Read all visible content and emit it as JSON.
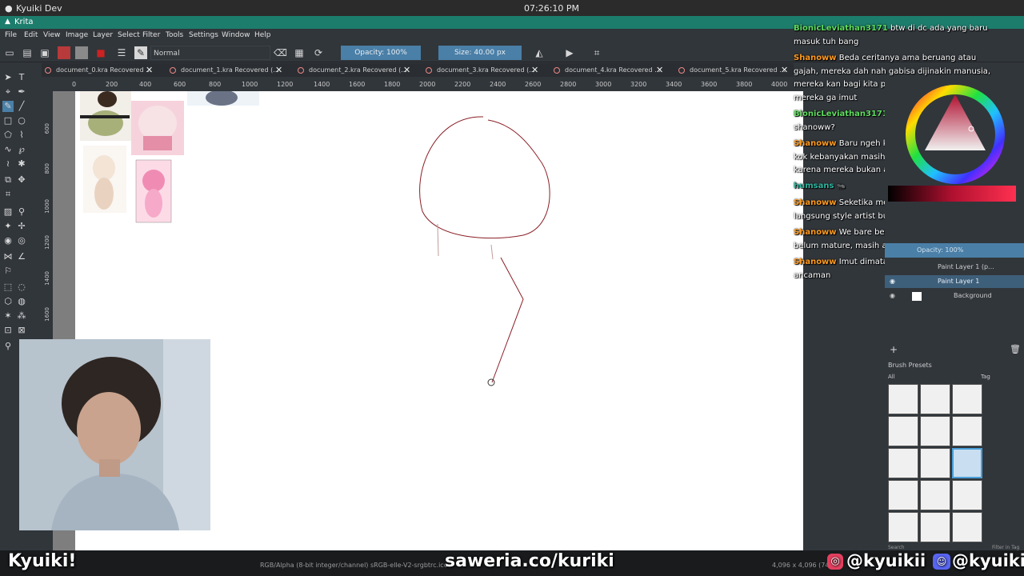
{
  "topbar": {
    "left": "Kyuiki Dev",
    "clock": "07:26:10 PM"
  },
  "app": {
    "title": "Krita"
  },
  "menu": [
    "File",
    "Edit",
    "View",
    "Image",
    "Layer",
    "Select",
    "Filter",
    "Tools",
    "Settings",
    "Window",
    "Help"
  ],
  "toolbar": {
    "blend_mode": "Normal",
    "opacity": "Opacity: 100%",
    "size": "Size: 40.00 px"
  },
  "tabs": [
    "document_0.kra Recovered ...",
    "document_1.kra Recovered (...",
    "document_2.kra Recovered (...",
    "document_3.kra Recovered (...",
    "document_4.kra Recovered ...",
    "document_5.kra Recovered ..."
  ],
  "ruler_top": [
    "0",
    "200",
    "400",
    "600",
    "800",
    "1000",
    "1200",
    "1400",
    "1600",
    "1800",
    "2000",
    "2200",
    "2400",
    "2600",
    "2800",
    "3000",
    "3200",
    "3400",
    "3600",
    "3800",
    "4000"
  ],
  "ruler_left": [
    "600",
    "800",
    "1000",
    "1200",
    "1400",
    "1600",
    "1800"
  ],
  "chat": [
    {
      "user": "BionicLeviathan3171",
      "color": "#5fdc5f",
      "text": "btw di dc ada yang baru masuk tuh bang"
    },
    {
      "user": "Shanoww",
      "color": "#ff9a1f",
      "text": "Beda ceritanya ama beruang atau gajah, mereka dah nah gabisa dijinakin manusia, mereka kan bagi kita predator utama, jadi kita liat mereka ga imut"
    },
    {
      "user": "BionicLeviathan3171",
      "color": "#5fdc5f",
      "text": "ini mau buat apa bang shanoww?"
    },
    {
      "user": "Shanoww",
      "color": "#ff9a1f",
      "text": "Baru ngeh kenapa kok kalo beruang kok kebanyakan masih muda dibuat imutnya? Ya karena mereka bukan ancaman kita"
    },
    {
      "user": "humsans",
      "color": "#2fb5a0",
      "text": ""
    },
    {
      "user": "Shanoww",
      "color": "#ff9a1f",
      "text": "Seketika mereka dah bukan bear cub, langsung style artist buat jadi garang kan?"
    },
    {
      "user": "Shanoww",
      "color": "#ff9a1f",
      "text": "We bare bears ajalah, 3 beruang itu kan belum mature, masih anakan beruang ceritanya"
    },
    {
      "user": "Shanoww",
      "color": "#ff9a1f",
      "text": "Imut dimata kita karena mereka bukan ancaman"
    }
  ],
  "layers": {
    "opacity": "Opacity: 100%",
    "items": [
      "Paint Layer 1 (p...",
      "Paint Layer 1",
      "Background"
    ]
  },
  "brush_presets": {
    "title": "Brush Presets",
    "filter": "All",
    "tag": "Tag",
    "search": "Search",
    "filter_in_tag": "Filter in Tag"
  },
  "status": {
    "color_space": "RGB/Alpha (8-bit integer/channel)  sRGB-elle-V2-srgbtrc.icc",
    "dimensions": "4,096 x 4,096 (74..."
  },
  "overlay": {
    "name": "Kyuiki!",
    "saweria": "saweria.co/kuriki",
    "instagram": "@kyuikii",
    "discord": "@kyuiki"
  },
  "colors": {
    "accent": "#4a7fa7",
    "titlebar": "#1d7d6d",
    "sketch_line": "#8a1f26"
  }
}
